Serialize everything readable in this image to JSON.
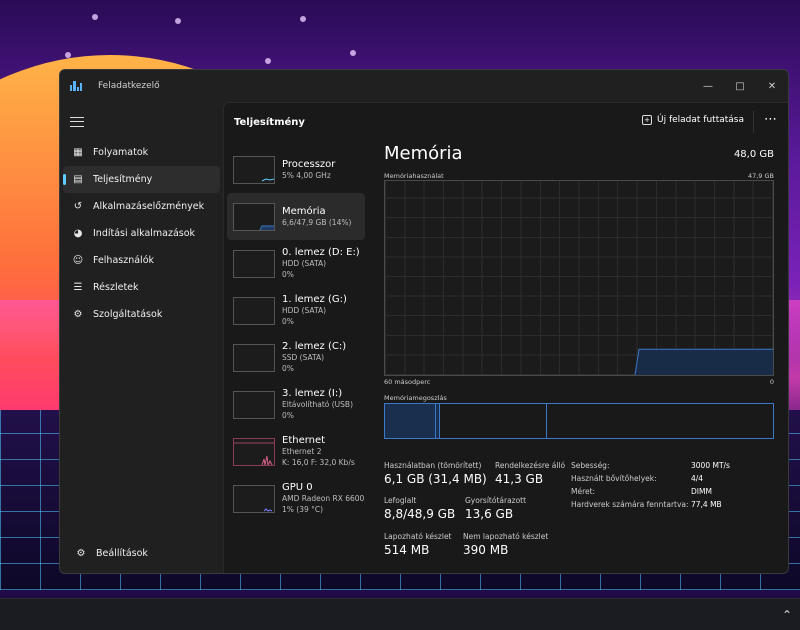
{
  "window": {
    "title": "Feladatkezelő"
  },
  "nav": {
    "items": [
      {
        "label": "Folyamatok",
        "icon": "processes-icon"
      },
      {
        "label": "Teljesítmény",
        "icon": "performance-icon"
      },
      {
        "label": "Alkalmazáselőzmények",
        "icon": "app-history-icon"
      },
      {
        "label": "Indítási alkalmazások",
        "icon": "startup-icon"
      },
      {
        "label": "Felhasználók",
        "icon": "users-icon"
      },
      {
        "label": "Részletek",
        "icon": "details-icon"
      },
      {
        "label": "Szolgáltatások",
        "icon": "services-icon"
      }
    ],
    "settings": "Beállítások"
  },
  "header": {
    "title": "Teljesítmény",
    "run_task": "Új feladat futtatása"
  },
  "devices": [
    {
      "name": "Processzor",
      "sub1": "5% 4,00 GHz",
      "sub2": ""
    },
    {
      "name": "Memória",
      "sub1": "6,6/47,9 GB (14%)",
      "sub2": ""
    },
    {
      "name": "0. lemez (D: E:)",
      "sub1": "HDD (SATA)",
      "sub2": "0%"
    },
    {
      "name": "1. lemez (G:)",
      "sub1": "HDD (SATA)",
      "sub2": "0%"
    },
    {
      "name": "2. lemez (C:)",
      "sub1": "SSD (SATA)",
      "sub2": "0%"
    },
    {
      "name": "3. lemez (I:)",
      "sub1": "Eltávolítható (USB)",
      "sub2": "0%"
    },
    {
      "name": "Ethernet",
      "sub1": "Ethernet 2",
      "sub2": "K: 16,0 F: 32,0 Kb/s"
    },
    {
      "name": "GPU 0",
      "sub1": "AMD Radeon RX 6600",
      "sub2": "1% (39 °C)"
    }
  ],
  "memory": {
    "title": "Memória",
    "total": "48,0 GB",
    "usage_label": "Memóriahasználat",
    "usage_max": "47,9 GB",
    "axis_left": "60 másodperc",
    "axis_right": "0",
    "composition_label": "Memóriamegoszlás",
    "stats": {
      "in_use_label": "Használatban (tömörített)",
      "in_use": "6,1 GB (31,4 MB)",
      "available_label": "Rendelkezésre álló",
      "available": "41,3 GB",
      "committed_label": "Lefoglalt",
      "committed": "8,8/48,9 GB",
      "cached_label": "Gyorsítótárazott",
      "cached": "13,6 GB",
      "paged_label": "Lapozható készlet",
      "paged": "514 MB",
      "nonpaged_label": "Nem lapozható készlet",
      "nonpaged": "390 MB"
    },
    "details": [
      {
        "k": "Sebesség:",
        "v": "3000 MT/s"
      },
      {
        "k": "Használt bővítőhelyek:",
        "v": "4/4"
      },
      {
        "k": "Méret:",
        "v": "DIMM"
      },
      {
        "k": "Hardverek számára fenntartva:",
        "v": "77,4 MB"
      }
    ]
  },
  "colors": {
    "accent": "#60cdff",
    "memory": "#3a78c8"
  }
}
